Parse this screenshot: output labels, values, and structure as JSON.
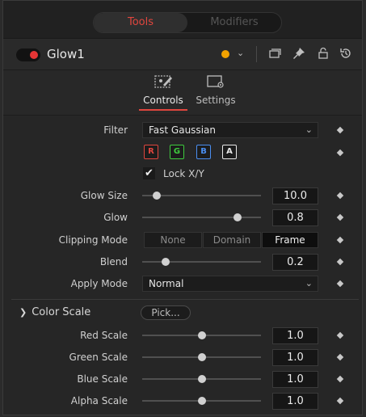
{
  "top_tabs": [
    {
      "label": "Tools",
      "active": true
    },
    {
      "label": "Modifiers",
      "active": false
    }
  ],
  "node": {
    "name": "Glow1",
    "enabled": true,
    "color": "#f2a200",
    "icons": [
      "version-icon",
      "pin-icon",
      "lock-icon",
      "reset-icon"
    ]
  },
  "page_tabs": [
    {
      "label": "Controls",
      "active": true,
      "icon": "controls-icon"
    },
    {
      "label": "Settings",
      "active": false,
      "icon": "settings-icon"
    }
  ],
  "filter": {
    "label": "Filter",
    "value": "Fast Gaussian"
  },
  "channels": [
    {
      "label": "R",
      "color": "#e0463e"
    },
    {
      "label": "G",
      "color": "#3ecc3e"
    },
    {
      "label": "B",
      "color": "#4a8ef0"
    },
    {
      "label": "A",
      "color": "#e8e8e8"
    }
  ],
  "lock_xy": {
    "label": "Lock X/Y",
    "checked": true
  },
  "glow_size": {
    "label": "Glow Size",
    "value": "10.0",
    "slider": 0.12
  },
  "glow": {
    "label": "Glow",
    "value": "0.8",
    "slider": 0.8
  },
  "clipping_mode": {
    "label": "Clipping Mode",
    "options": [
      "None",
      "Domain",
      "Frame"
    ],
    "selected": "Frame"
  },
  "blend": {
    "label": "Blend",
    "value": "0.2",
    "slider": 0.2
  },
  "apply_mode": {
    "label": "Apply Mode",
    "value": "Normal"
  },
  "color_scale": {
    "title": "Color Scale",
    "pick_label": "Pick...",
    "rows": [
      {
        "label": "Red Scale",
        "value": "1.0",
        "slider": 0.5
      },
      {
        "label": "Green Scale",
        "value": "1.0",
        "slider": 0.5
      },
      {
        "label": "Blue Scale",
        "value": "1.0",
        "slider": 0.5
      },
      {
        "label": "Alpha Scale",
        "value": "1.0",
        "slider": 0.5
      }
    ]
  }
}
